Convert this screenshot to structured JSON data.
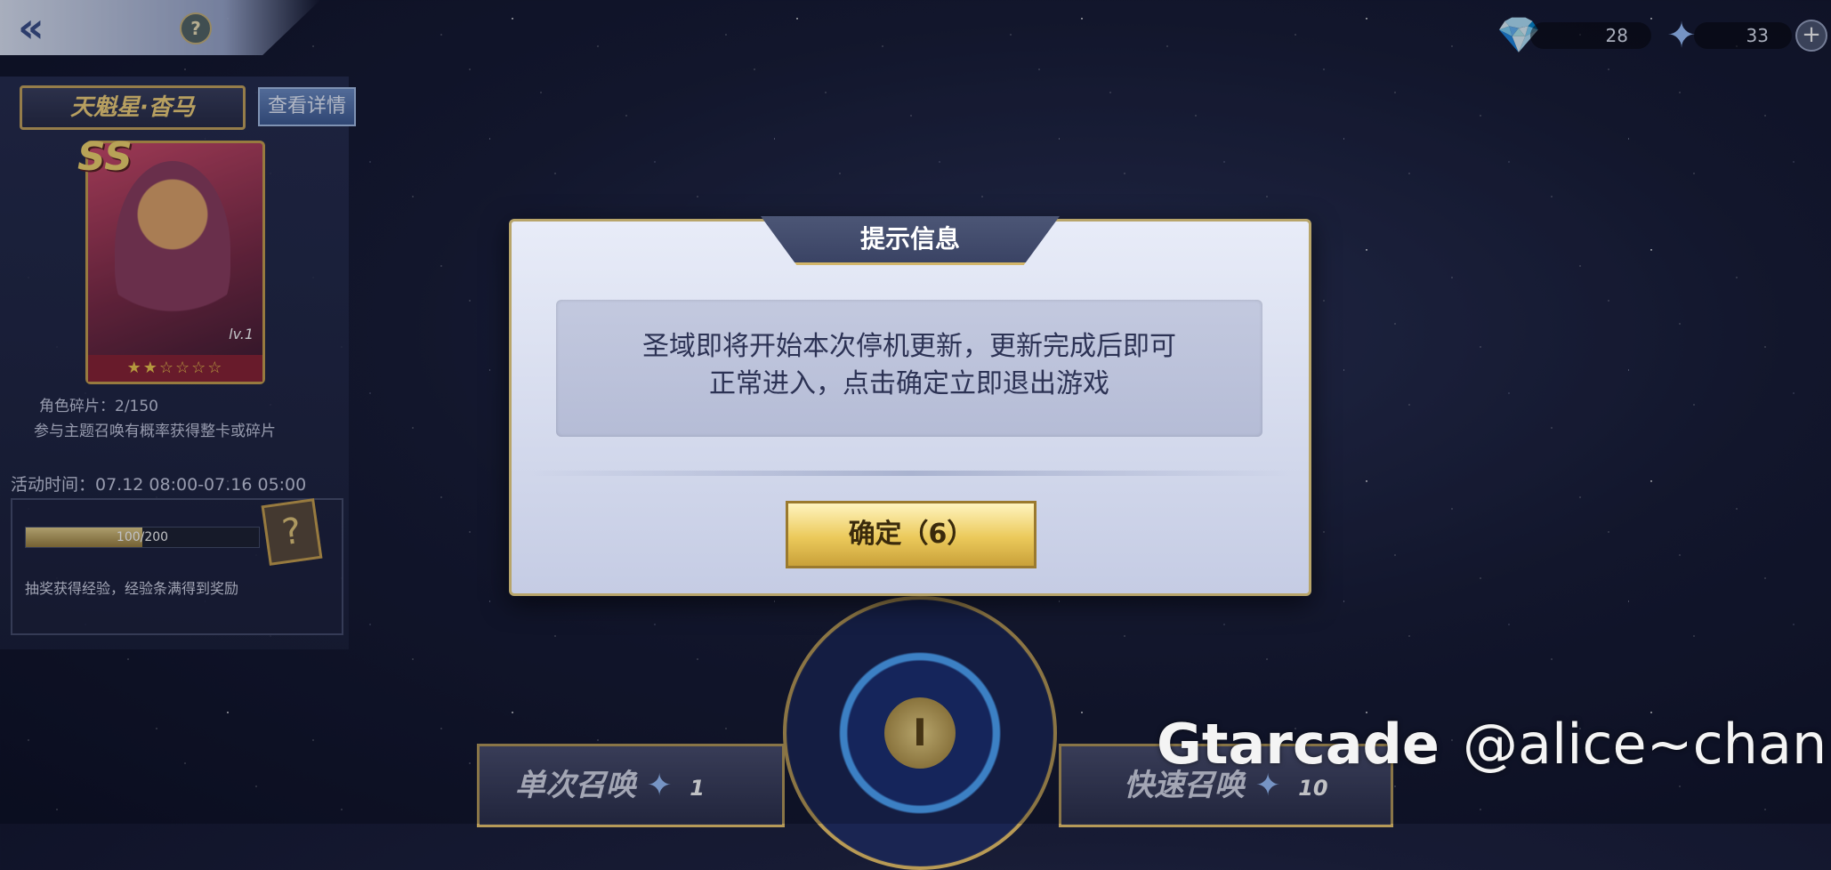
{
  "topbar": {
    "back_icon": "«",
    "help_icon": "?"
  },
  "currency": {
    "gems": {
      "icon": "gem-icon",
      "value": "28"
    },
    "stars": {
      "icon": "star-icon",
      "value": "33"
    },
    "add_icon": "+"
  },
  "character": {
    "name": "天魁星·杳马",
    "detail_button": "查看详情",
    "rank": "SS",
    "level": "lv.1",
    "stars_filled": 2,
    "stars_total": 6,
    "fragments": "角色碎片：2/150",
    "tip": "参与主题召唤有概率获得整卡或碎片"
  },
  "event": {
    "time": "活动时间：07.12 08:00-07.16 05:00",
    "exp_text": "100/200",
    "exp_progress": 0.5,
    "mystery_icon": "?",
    "exp_tip": "抽奖获得经验，经验条满得到奖励"
  },
  "summon": {
    "single_label": "单次召唤",
    "single_cost": "1",
    "fast_label": "快速召唤",
    "fast_cost": "10"
  },
  "dialog": {
    "title": "提示信息",
    "message_line1": "圣域即将开始本次停机更新，更新完成后即可",
    "message_line2": "正常进入，点击确定立即退出游戏",
    "ok_button": "确定（6）"
  },
  "watermark": {
    "brand": "Gtarcade",
    "handle": "@alice~chan"
  },
  "colors": {
    "accent_gold": "#ebc95a",
    "dialog_bg": "#e8ecf8",
    "text_dark": "#2c3254"
  }
}
